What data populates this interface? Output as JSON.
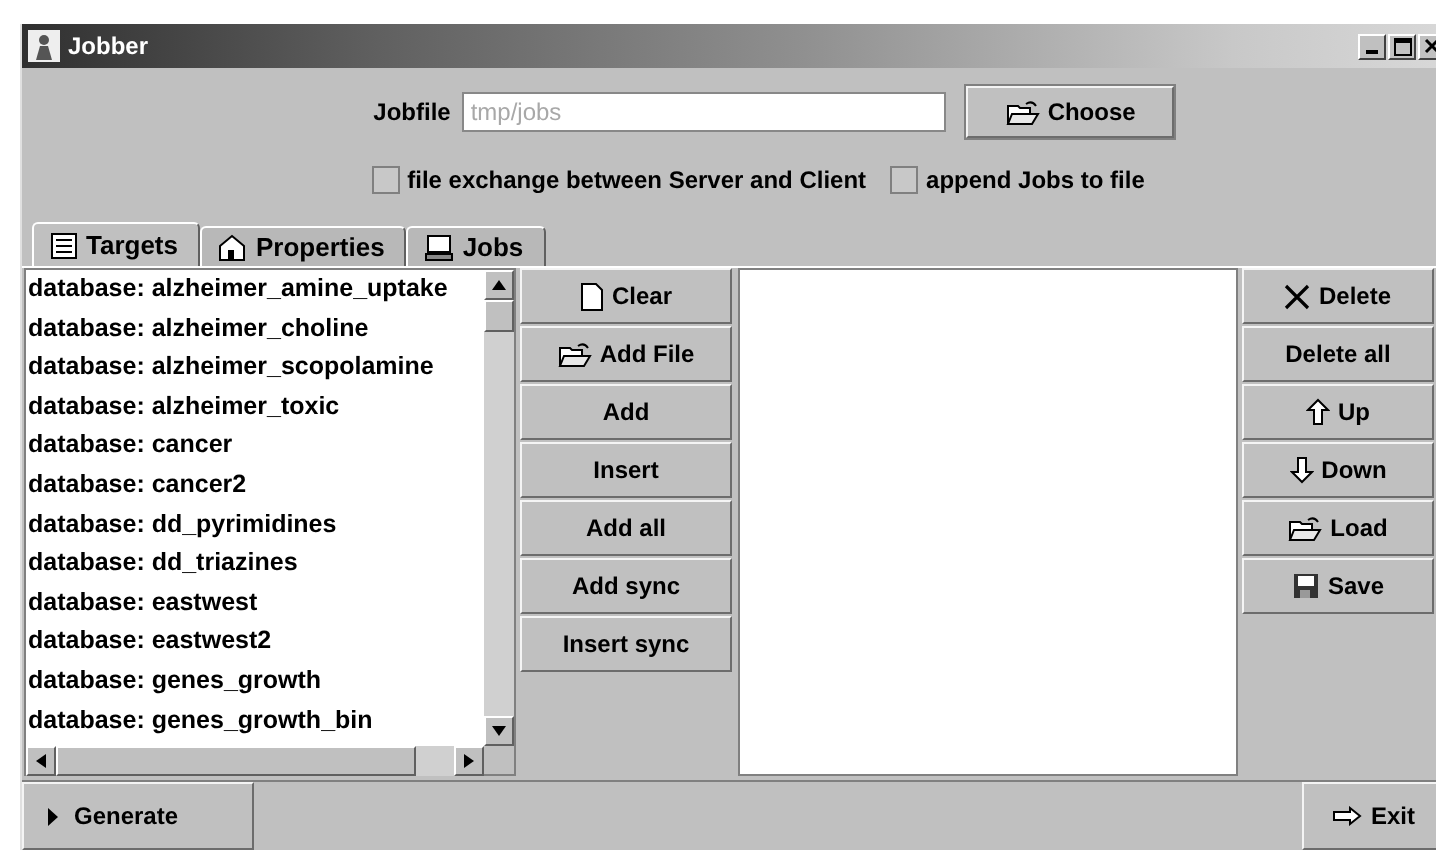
{
  "window": {
    "title": "Jobber"
  },
  "jobfile": {
    "label": "Jobfile",
    "placeholder": "tmp/jobs",
    "button": "Choose"
  },
  "options": [
    {
      "label": "file exchange between Server and Client",
      "checked": false
    },
    {
      "label": "append Jobs to file",
      "checked": false
    }
  ],
  "tabs": [
    {
      "label": "Targets",
      "kind": "card",
      "selected": true
    },
    {
      "label": "Properties",
      "kind": "house",
      "selected": false
    },
    {
      "label": "Jobs",
      "kind": "computer",
      "selected": false
    }
  ],
  "databases": [
    "database: alzheimer_amine_uptake",
    "database: alzheimer_choline",
    "database: alzheimer_scopolamine",
    "database: alzheimer_toxic",
    "database: cancer",
    "database: cancer2",
    "database: dd_pyrimidines",
    "database: dd_triazines",
    "database: eastwest",
    "database: eastwest2",
    "database: genes_growth",
    "database: genes_growth_bin"
  ],
  "middle_buttons": [
    {
      "label": "Clear",
      "kind": "page"
    },
    {
      "label": "Add File",
      "kind": "folder"
    },
    {
      "label": "Add",
      "kind": "plain"
    },
    {
      "label": "Insert",
      "kind": "plain"
    },
    {
      "label": "Add all",
      "kind": "plain"
    },
    {
      "label": "Add sync",
      "kind": "plain"
    },
    {
      "label": "Insert sync",
      "kind": "plain"
    }
  ],
  "right_buttons": [
    {
      "label": "Delete",
      "kind": "cross"
    },
    {
      "label": "Delete all",
      "kind": "plain"
    },
    {
      "label": "Up",
      "kind": "up"
    },
    {
      "label": "Down",
      "kind": "down"
    },
    {
      "label": "Load",
      "kind": "folder"
    },
    {
      "label": "Save",
      "kind": "disk"
    }
  ],
  "footer": {
    "generate": "Generate",
    "exit": "Exit"
  }
}
